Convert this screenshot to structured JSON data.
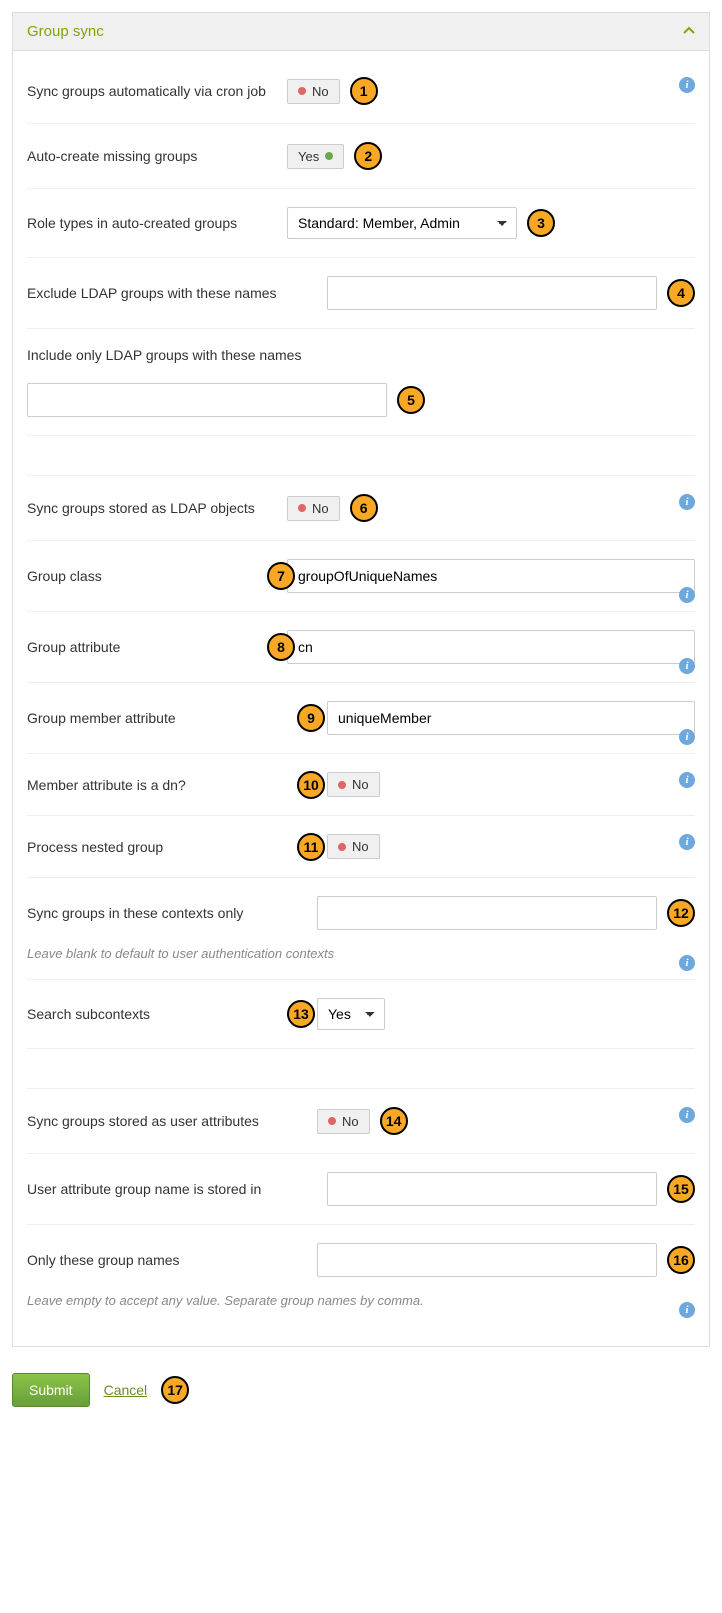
{
  "panel": {
    "title": "Group sync"
  },
  "toggles": {
    "no": "No",
    "yes": "Yes"
  },
  "fields": {
    "sync_cron": {
      "label": "Sync groups automatically via cron job",
      "value": "No",
      "marker": "1"
    },
    "auto_create": {
      "label": "Auto-create missing groups",
      "value": "Yes",
      "marker": "2"
    },
    "role_types": {
      "label": "Role types in auto-created groups",
      "value": "Standard: Member, Admin",
      "marker": "3"
    },
    "exclude": {
      "label": "Exclude LDAP groups with these names",
      "value": "",
      "marker": "4"
    },
    "include": {
      "label": "Include only LDAP groups with these names",
      "value": "",
      "marker": "5"
    },
    "sync_objects": {
      "label": "Sync groups stored as LDAP objects",
      "value": "No",
      "marker": "6"
    },
    "group_class": {
      "label": "Group class",
      "value": "groupOfUniqueNames",
      "marker": "7"
    },
    "group_attr": {
      "label": "Group attribute",
      "value": "cn",
      "marker": "8"
    },
    "group_member_attr": {
      "label": "Group member attribute",
      "value": "uniqueMember",
      "marker": "9"
    },
    "member_dn": {
      "label": "Member attribute is a dn?",
      "value": "No",
      "marker": "10"
    },
    "nested": {
      "label": "Process nested group",
      "value": "No",
      "marker": "11"
    },
    "sync_contexts": {
      "label": "Sync groups in these contexts only",
      "value": "",
      "help": "Leave blank to default to user authentication contexts",
      "marker": "12"
    },
    "subcontexts": {
      "label": "Search subcontexts",
      "value": "Yes",
      "marker": "13"
    },
    "sync_user_attrs": {
      "label": "Sync groups stored as user attributes",
      "value": "No",
      "marker": "14"
    },
    "user_attr_name": {
      "label": "User attribute group name is stored in",
      "value": "",
      "marker": "15"
    },
    "only_names": {
      "label": "Only these group names",
      "value": "",
      "help": "Leave empty to accept any value. Separate group names by comma.",
      "marker": "16"
    }
  },
  "buttons": {
    "submit": "Submit",
    "cancel": "Cancel",
    "cancel_marker": "17"
  }
}
